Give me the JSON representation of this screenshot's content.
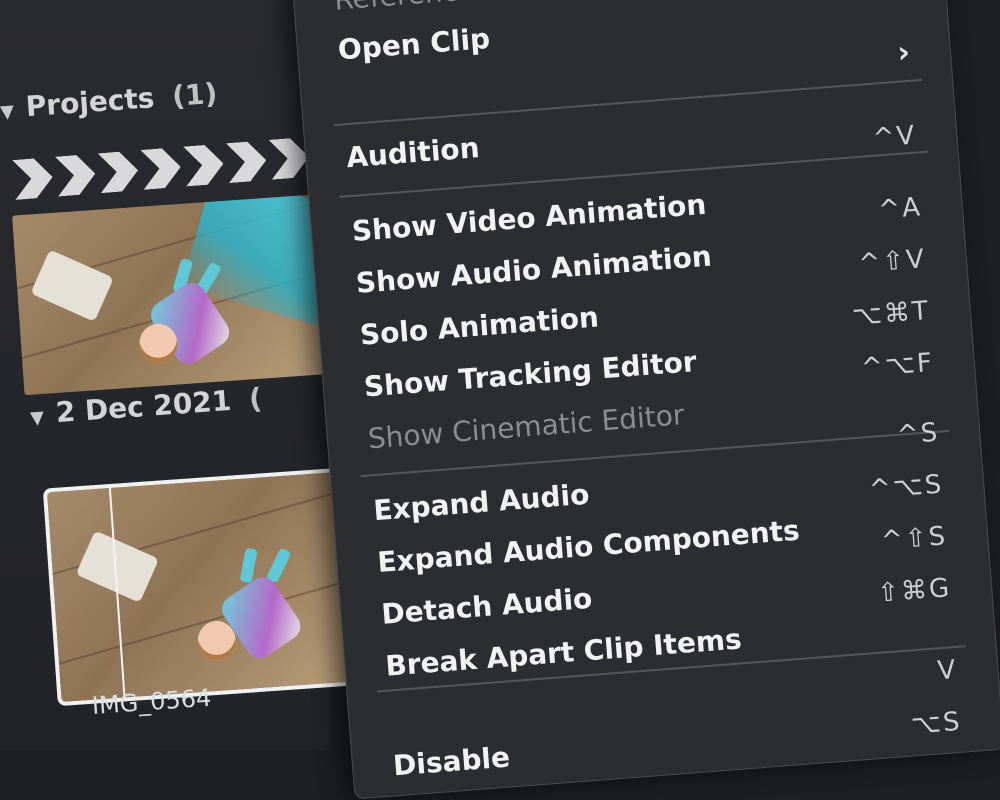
{
  "browser": {
    "projects_header": "Projects",
    "projects_count": "(1)",
    "date_header": "2 Dec 2021",
    "date_count": "(",
    "clip_name": "IMG_0564"
  },
  "menu": {
    "top_partial": "Reference",
    "items": [
      {
        "label": "Open Clip",
        "shortcut": "",
        "submenu": true
      },
      {
        "label": "Audition",
        "shortcut": "^V"
      },
      {
        "label": "Show Video Animation",
        "shortcut": "^A"
      },
      {
        "label": "Show Audio Animation",
        "shortcut": "^⇧V"
      },
      {
        "label": "Solo Animation",
        "shortcut": "⌥⌘T"
      },
      {
        "label": "Show Tracking Editor",
        "shortcut": "^⌥F"
      },
      {
        "label": "Show Cinematic Editor",
        "shortcut": "",
        "disabled": true
      },
      {
        "label": "Expand Audio",
        "shortcut": "^S"
      },
      {
        "label": "Expand Audio Components",
        "shortcut": "^⌥S"
      },
      {
        "label": "Detach Audio",
        "shortcut": "^⇧S"
      },
      {
        "label": "Break Apart Clip Items",
        "shortcut": "⇧⌘G"
      },
      {
        "label": "",
        "shortcut": "V"
      },
      {
        "label": "Disable",
        "shortcut": "⌥S"
      }
    ]
  },
  "icons": {
    "triangle": "disclosure-triangle-icon",
    "chevron": "chevron-right-icon"
  }
}
